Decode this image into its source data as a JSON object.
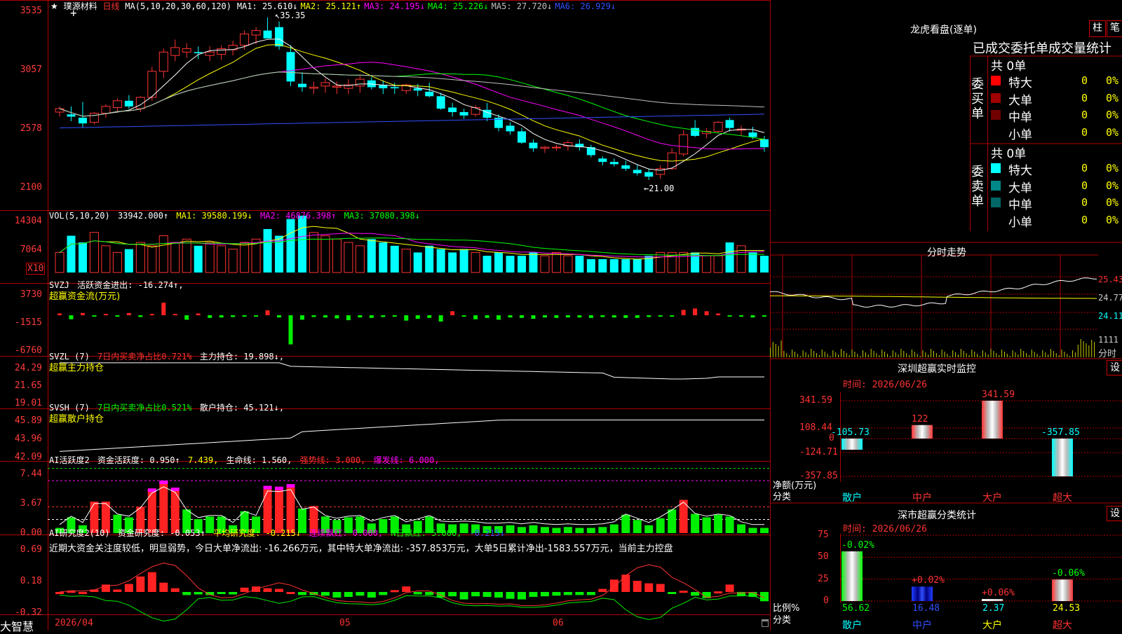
{
  "stock": {
    "name": "璞源材料",
    "period": "日线"
  },
  "main_header": {
    "ma_params": "MA(5,10,20,30,60,120)",
    "mas": [
      {
        "label": "MA1:",
        "value": "25.610↓",
        "color": "#ffffff"
      },
      {
        "label": "MA2:",
        "value": "25.121↑",
        "color": "#ffff00"
      },
      {
        "label": "MA3:",
        "value": "24.195↓",
        "color": "#ff00ff"
      },
      {
        "label": "MA4:",
        "value": "25.226↓",
        "color": "#00ff00"
      },
      {
        "label": "MA5:",
        "value": "27.720↓",
        "color": "#c0c0c0"
      },
      {
        "label": "MA6:",
        "value": "26.929↓",
        "color": "#3050ff"
      }
    ]
  },
  "price_axis": [
    "3535",
    "3057",
    "2578",
    "2100"
  ],
  "price_annotations": {
    "high": "35.35",
    "low": "←21.00"
  },
  "vol_header": {
    "label": "VOL(5,10,20)",
    "value": "33942.000↑",
    "ma1": "MA1: 39580.199↓",
    "ma2": "MA2: 46876.398↑",
    "ma3": "MA3: 37080.398↓"
  },
  "vol_axis": [
    "14304",
    "7064"
  ],
  "vol_unit": "X10",
  "svzj": {
    "label": "SVZJ",
    "text": "活跃资金进出: -16.274↑,",
    "sub": "超赢资金流(万元)",
    "axis": [
      "3730",
      "-1515",
      "-6760"
    ]
  },
  "svzl": {
    "label": "SVZL (7)",
    "text1": "7日内买卖净占比0.721%",
    "text2": "主力持仓: 19.898↓,",
    "sub": "超赢主力持仓",
    "axis": [
      "24.29",
      "21.65",
      "19.01"
    ]
  },
  "svsh": {
    "label": "SVSH (7)",
    "text1": "7日内买卖净占比0.521%",
    "text2": "散户持仓: 45.121↓,",
    "sub": "超赢散户持仓",
    "axis": [
      "45.89",
      "43.96",
      "42.09"
    ]
  },
  "ai_act": {
    "label": "AI活跃度2",
    "t1": "资金活跃度: 0.950↑",
    "t2": "7.439,",
    "t3": "生命线: 1.560,",
    "t4": "强势线: 3.000,",
    "t5": "爆发线: 6.000,",
    "axis": [
      "7.44",
      "3.67",
      "0.00"
    ]
  },
  "ai_res": {
    "label": "AI研究度2(10)",
    "t1": "资金研究度: -0.053↑",
    "t2": "平均研究度: -0.215↓",
    "t3": "连续飘红: 0.000,",
    "t4": "N日飘红: 5.000,",
    "t5": "-0.215↓",
    "axis": [
      "0.69",
      "0.18",
      "-0.32"
    ],
    "summary": "近期大资金关注度较低，明显弱势，今日大单净流出: -16.266万元，其中特大单净流出: -357.853万元，大单5日累计净出-1583.557万元，当前主力控盘"
  },
  "date_axis": [
    "2026/04",
    "05",
    "06"
  ],
  "brand": "大智慧",
  "dragon": {
    "title": "龙虎看盘(逐单)",
    "btn1": "柱",
    "btn2": "笔",
    "subtitle": "已成交委托单成交量统计",
    "buy": {
      "side": "委买单",
      "total": "共 0单",
      "rows": [
        {
          "name": "特大",
          "count": "0",
          "pct": "0%",
          "color": "#ff0000"
        },
        {
          "name": "大单",
          "count": "0",
          "pct": "0%",
          "color": "#a00000"
        },
        {
          "name": "中单",
          "count": "0",
          "pct": "0%",
          "color": "#700000"
        },
        {
          "name": "小单",
          "count": "0",
          "pct": "0%",
          "color": "#000000"
        }
      ]
    },
    "sell": {
      "side": "委卖单",
      "total": "共 0单",
      "rows": [
        {
          "name": "特大",
          "count": "0",
          "pct": "0%",
          "color": "#00ffff"
        },
        {
          "name": "大单",
          "count": "0",
          "pct": "0%",
          "color": "#008888"
        },
        {
          "name": "中单",
          "count": "0",
          "pct": "0%",
          "color": "#006666"
        },
        {
          "name": "小单",
          "count": "0",
          "pct": "0%",
          "color": "#000000"
        }
      ]
    }
  },
  "intraday": {
    "title": "分时走势",
    "axis": [
      "25.43",
      "24.77",
      "24.11"
    ],
    "vol_axis": [
      "1111",
      "分时"
    ]
  },
  "sz_monitor": {
    "title": "深圳超赢实时监控",
    "btn": "设",
    "time": "时间: 2026/06/26",
    "axis": [
      "341.59",
      "108.44",
      "0",
      "-124.71",
      "-357.85"
    ],
    "ylabel": "净额(万元)",
    "xlabel": "分类",
    "bars": [
      {
        "cat": "散户",
        "value": -105.73,
        "label": "-105.73"
      },
      {
        "cat": "中户",
        "value": 122,
        "label": "122"
      },
      {
        "cat": "大户",
        "value": 341.59,
        "label": "341.59"
      },
      {
        "cat": "超大",
        "value": -357.85,
        "label": "-357.85"
      }
    ]
  },
  "sz_class": {
    "title": "深市超赢分类统计",
    "btn": "设",
    "time": "时间: 2026/06/26",
    "axis": [
      "75",
      "50",
      "25",
      "0"
    ],
    "ylabel": "比例%",
    "xlabel": "分类",
    "bars": [
      {
        "cat": "散户",
        "value": 56.62,
        "change": "-0.02%"
      },
      {
        "cat": "中户",
        "value": 16.48,
        "change": "+0.02%"
      },
      {
        "cat": "大户",
        "value": 2.37,
        "change": "+0.06%"
      },
      {
        "cat": "超大",
        "value": 24.53,
        "change": "-0.06%"
      }
    ]
  },
  "chart_data": [
    {
      "type": "candlestick",
      "title": "璞源材料 日线",
      "x": [
        "04",
        "05",
        "06"
      ],
      "ylim": [
        21.0,
        35.35
      ],
      "ohlc": [
        [
          27.0,
          27.5,
          26.6,
          27.3
        ],
        [
          26.8,
          27.5,
          26.2,
          26.6
        ],
        [
          26.5,
          27.9,
          25.6,
          26.0
        ],
        [
          26.1,
          27.0,
          25.9,
          26.9
        ],
        [
          26.9,
          27.7,
          26.5,
          27.5
        ],
        [
          27.4,
          28.2,
          27.0,
          28.0
        ],
        [
          28.0,
          28.5,
          27.3,
          27.5
        ],
        [
          27.3,
          28.4,
          27.0,
          28.3
        ],
        [
          28.3,
          31.0,
          28.0,
          30.6
        ],
        [
          30.6,
          32.6,
          30.0,
          32.3
        ],
        [
          32.0,
          33.4,
          31.5,
          32.7
        ],
        [
          32.3,
          33.1,
          31.8,
          32.6
        ],
        [
          32.3,
          32.8,
          31.7,
          32.2
        ],
        [
          32.0,
          32.8,
          31.5,
          32.3
        ],
        [
          32.1,
          32.9,
          31.6,
          32.6
        ],
        [
          32.5,
          33.3,
          32.0,
          32.9
        ],
        [
          32.9,
          34.2,
          32.5,
          33.9
        ],
        [
          33.8,
          34.5,
          33.0,
          34.2
        ],
        [
          34.2,
          35.35,
          33.6,
          33.5
        ],
        [
          34.5,
          35.0,
          32.5,
          32.8
        ],
        [
          32.3,
          32.9,
          29.3,
          29.7
        ],
        [
          29.5,
          30.5,
          28.8,
          29.2
        ],
        [
          29.1,
          29.7,
          28.6,
          29.2
        ],
        [
          29.3,
          30.0,
          28.7,
          29.6
        ],
        [
          29.2,
          29.7,
          28.6,
          29.3
        ],
        [
          29.1,
          29.9,
          28.6,
          29.4
        ],
        [
          29.3,
          30.2,
          28.7,
          29.9
        ],
        [
          29.8,
          30.1,
          29.0,
          29.2
        ],
        [
          29.4,
          29.8,
          28.6,
          29.1
        ],
        [
          29.2,
          29.6,
          28.6,
          29.1
        ],
        [
          28.9,
          29.5,
          28.6,
          29.4
        ],
        [
          29.1,
          29.5,
          28.4,
          28.9
        ],
        [
          28.8,
          29.6,
          28.3,
          28.4
        ],
        [
          28.4,
          28.7,
          27.2,
          27.3
        ],
        [
          27.4,
          27.8,
          26.6,
          27.0
        ],
        [
          27.0,
          27.3,
          26.4,
          26.7
        ],
        [
          26.8,
          27.6,
          26.6,
          27.4
        ],
        [
          27.2,
          27.8,
          26.2,
          26.5
        ],
        [
          26.5,
          26.8,
          25.3,
          25.6
        ],
        [
          25.8,
          26.1,
          25.0,
          25.3
        ],
        [
          25.3,
          25.6,
          24.2,
          24.3
        ],
        [
          24.3,
          24.6,
          23.5,
          23.8
        ],
        [
          23.8,
          24.0,
          23.4,
          23.9
        ],
        [
          23.9,
          24.1,
          23.6,
          23.9
        ],
        [
          24.0,
          24.5,
          23.6,
          24.3
        ],
        [
          24.2,
          24.6,
          23.6,
          23.9
        ],
        [
          23.9,
          24.1,
          23.0,
          23.2
        ],
        [
          22.9,
          23.1,
          22.3,
          22.6
        ],
        [
          22.6,
          22.9,
          22.2,
          22.4
        ],
        [
          22.3,
          22.7,
          21.8,
          22.0
        ],
        [
          21.9,
          22.3,
          21.4,
          21.6
        ],
        [
          21.7,
          22.0,
          21.0,
          21.3
        ],
        [
          21.5,
          22.3,
          21.1,
          22.0
        ],
        [
          22.0,
          23.8,
          21.9,
          23.4
        ],
        [
          23.3,
          25.4,
          23.1,
          25.0
        ],
        [
          25.6,
          26.3,
          24.8,
          24.9
        ],
        [
          25.1,
          25.6,
          24.7,
          25.3
        ],
        [
          25.3,
          26.2,
          25.2,
          26.1
        ],
        [
          26.3,
          26.5,
          25.3,
          25.6
        ],
        [
          25.4,
          25.8,
          24.9,
          25.5
        ],
        [
          25.2,
          25.7,
          24.6,
          24.8
        ],
        [
          24.6,
          24.9,
          23.5,
          23.9
        ]
      ]
    },
    {
      "type": "bar",
      "title": "VOL(5,10,20)",
      "values": [
        6,
        11,
        9,
        12,
        8,
        6,
        7,
        9,
        8,
        11,
        9,
        10,
        8,
        9,
        8,
        7,
        9,
        10,
        13,
        11,
        16,
        17,
        12,
        11,
        10,
        9,
        8,
        10,
        9,
        8,
        7,
        6,
        8,
        7,
        6,
        7,
        6,
        5,
        6,
        5,
        5,
        6,
        5,
        6,
        5,
        5,
        4,
        4,
        4,
        4,
        4,
        5,
        6,
        6,
        6,
        6,
        5,
        5,
        9,
        8,
        6,
        5
      ]
    },
    {
      "type": "bar",
      "title": "活跃资金进出",
      "values": [
        0.4,
        -0.9,
        0.5,
        -0.2,
        0.3,
        -0.3,
        0.5,
        -0.4,
        0.3,
        2.8,
        0.3,
        -1.0,
        0.4,
        -0.6,
        -0.5,
        -0.4,
        -0.3,
        -0.3,
        1.1,
        -0.5,
        -6.5,
        -1.0,
        -0.4,
        -0.5,
        -0.7,
        -1.1,
        -0.5,
        -0.6,
        -0.4,
        -0.3,
        -1.2,
        -0.8,
        -0.6,
        -1.4,
        0.9,
        -0.2,
        -0.9,
        -0.6,
        -1.0,
        -0.5,
        -0.6,
        -0.8,
        -0.5,
        -0.6,
        -0.5,
        -0.5,
        -0.6,
        -0.4,
        -0.5,
        -0.6,
        -0.6,
        -0.4,
        -0.3,
        -0.3,
        1.2,
        1.5,
        0.9,
        0.4,
        -0.3,
        -0.3,
        -0.5,
        -0.3
      ]
    },
    {
      "type": "bar",
      "title": "资金活跃度",
      "values": [
        0.6,
        1.8,
        0.9,
        3.6,
        3.6,
        2.1,
        1.8,
        3.0,
        5.1,
        6.0,
        5.2,
        2.7,
        1.6,
        1.9,
        1.9,
        0.9,
        2.5,
        1.9,
        5.4,
        5.3,
        5.6,
        2.8,
        3.1,
        1.9,
        1.5,
        1.8,
        1.9,
        1.1,
        1.6,
        1.9,
        1.0,
        1.4,
        1.9,
        1.1,
        1.0,
        1.1,
        1.0,
        0.8,
        0.8,
        0.9,
        0.7,
        0.9,
        0.7,
        0.6,
        0.7,
        0.6,
        0.6,
        0.7,
        1.0,
        2.1,
        1.5,
        0.9,
        1.7,
        2.7,
        3.8,
        2.2,
        1.8,
        2.1,
        1.9,
        1.0,
        0.6,
        0.6
      ]
    },
    {
      "type": "bar",
      "title": "资金研究度",
      "values": [
        0,
        0.02,
        0,
        0.04,
        0.12,
        0.04,
        0.13,
        0.25,
        0.32,
        0.15,
        0.06,
        -0.05,
        -0.04,
        -0.05,
        -0.03,
        -0.04,
        0.07,
        0.09,
        0.06,
        0.05,
        0,
        -0.05,
        -0.05,
        -0.06,
        -0.09,
        -0.08,
        -0.06,
        -0.09,
        -0.05,
        0.03,
        0.09,
        -0.04,
        -0.05,
        -0.09,
        -0.07,
        -0.12,
        -0.07,
        -0.08,
        -0.09,
        -0.11,
        -0.12,
        -0.08,
        -0.07,
        -0.06,
        -0.05,
        -0.05,
        -0.05,
        0.05,
        0.2,
        0.28,
        0.18,
        0.14,
        0.13,
        -0.02,
        0.02,
        -0.06,
        -0.1,
        0.01,
        0.12,
        -0.06,
        -0.08,
        -0.15
      ]
    }
  ]
}
